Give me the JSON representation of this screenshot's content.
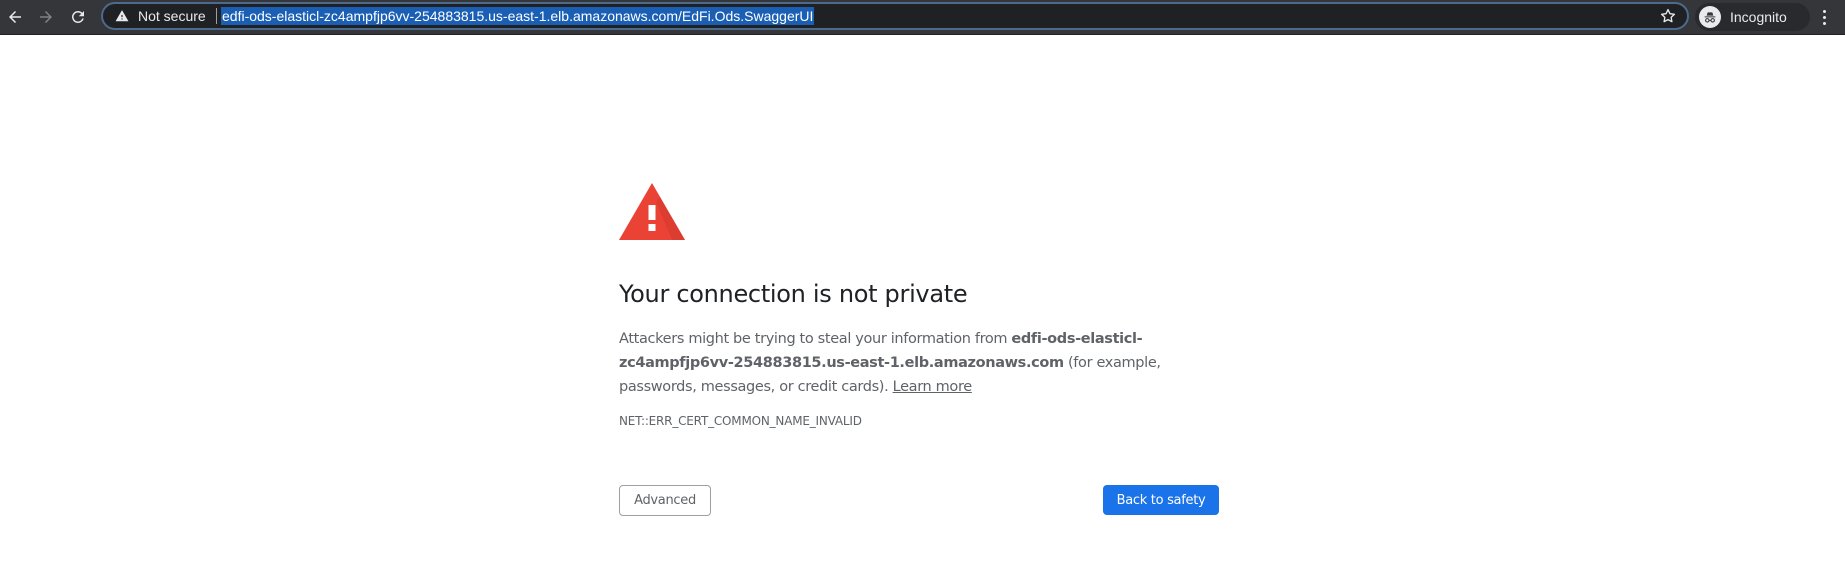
{
  "browser": {
    "security_label": "Not secure",
    "url": "edfi-ods-elasticl-zc4ampfjp6vv-254883815.us-east-1.elb.amazonaws.com/EdFi.Ods.SwaggerUI",
    "profile_label": "Incognito",
    "icons": {
      "back": "arrow-left-icon",
      "forward": "arrow-right-icon",
      "reload": "reload-icon",
      "security": "warning-triangle-icon",
      "bookmark": "star-icon",
      "profile": "incognito-icon",
      "menu": "kebab-menu-icon"
    }
  },
  "page": {
    "icon": "warning-triangle-icon",
    "icon_color": "#ea4335",
    "title": "Your connection is not private",
    "description_prefix": "Attackers might be trying to steal your information from ",
    "host": "edfi-ods-elasticl-zc4ampfjp6vv-254883815.us-east-1.elb.amazonaws.com",
    "description_suffix": " (for example, passwords, messages, or credit cards). ",
    "learn_more": "Learn more",
    "error_code": "NET::ERR_CERT_COMMON_NAME_INVALID",
    "advanced_label": "Advanced",
    "back_to_safety_label": "Back to safety",
    "primary_color": "#1a73e8"
  }
}
